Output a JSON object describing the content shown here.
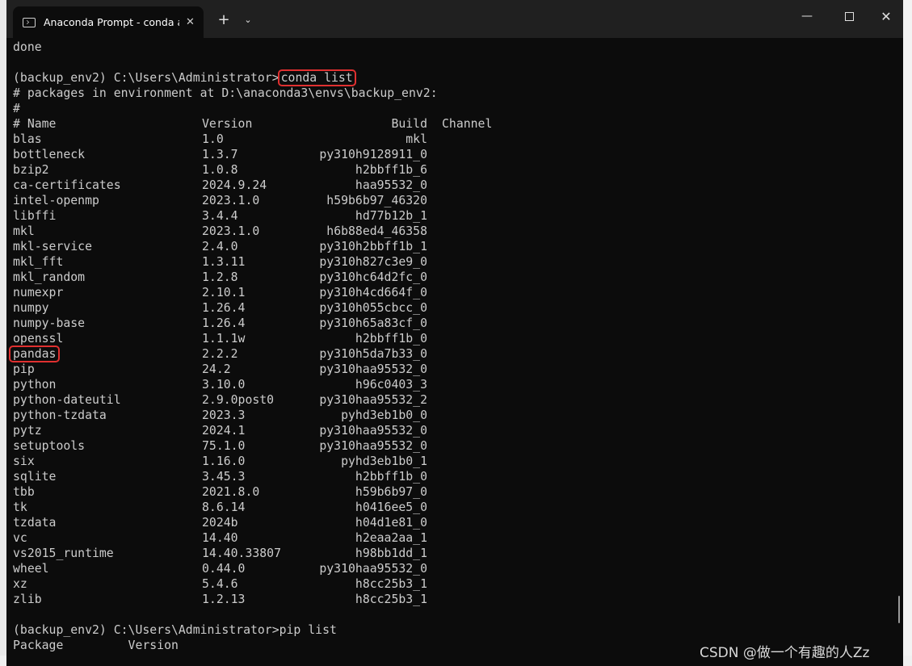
{
  "window": {
    "tab_title": "Anaconda Prompt - conda  ac",
    "tab_close": "✕",
    "new_tab": "+",
    "dropdown": "⌄",
    "minimize": "—",
    "close": "✕"
  },
  "terminal": {
    "pre_lines": [
      "done",
      ""
    ],
    "prompt1": "(backup_env2) C:\\Users\\Administrator>",
    "command1": "conda list",
    "env_comment": "# packages in environment at D:\\anaconda3\\envs\\backup_env2:",
    "hash_line": "#",
    "header": {
      "name": "# Name",
      "version": "Version",
      "build": "Build",
      "channel": "Channel"
    },
    "packages": [
      {
        "name": "blas",
        "version": "1.0",
        "build": "mkl"
      },
      {
        "name": "bottleneck",
        "version": "1.3.7",
        "build": "py310h9128911_0"
      },
      {
        "name": "bzip2",
        "version": "1.0.8",
        "build": "h2bbff1b_6"
      },
      {
        "name": "ca-certificates",
        "version": "2024.9.24",
        "build": "haa95532_0"
      },
      {
        "name": "intel-openmp",
        "version": "2023.1.0",
        "build": "h59b6b97_46320"
      },
      {
        "name": "libffi",
        "version": "3.4.4",
        "build": "hd77b12b_1"
      },
      {
        "name": "mkl",
        "version": "2023.1.0",
        "build": "h6b88ed4_46358"
      },
      {
        "name": "mkl-service",
        "version": "2.4.0",
        "build": "py310h2bbff1b_1"
      },
      {
        "name": "mkl_fft",
        "version": "1.3.11",
        "build": "py310h827c3e9_0"
      },
      {
        "name": "mkl_random",
        "version": "1.2.8",
        "build": "py310hc64d2fc_0"
      },
      {
        "name": "numexpr",
        "version": "2.10.1",
        "build": "py310h4cd664f_0"
      },
      {
        "name": "numpy",
        "version": "1.26.4",
        "build": "py310h055cbcc_0"
      },
      {
        "name": "numpy-base",
        "version": "1.26.4",
        "build": "py310h65a83cf_0"
      },
      {
        "name": "openssl",
        "version": "1.1.1w",
        "build": "h2bbff1b_0"
      },
      {
        "name": "pandas",
        "version": "2.2.2",
        "build": "py310h5da7b33_0"
      },
      {
        "name": "pip",
        "version": "24.2",
        "build": "py310haa95532_0"
      },
      {
        "name": "python",
        "version": "3.10.0",
        "build": "h96c0403_3"
      },
      {
        "name": "python-dateutil",
        "version": "2.9.0post0",
        "build": "py310haa95532_2"
      },
      {
        "name": "python-tzdata",
        "version": "2023.3",
        "build": "pyhd3eb1b0_0"
      },
      {
        "name": "pytz",
        "version": "2024.1",
        "build": "py310haa95532_0"
      },
      {
        "name": "setuptools",
        "version": "75.1.0",
        "build": "py310haa95532_0"
      },
      {
        "name": "six",
        "version": "1.16.0",
        "build": "pyhd3eb1b0_1"
      },
      {
        "name": "sqlite",
        "version": "3.45.3",
        "build": "h2bbff1b_0"
      },
      {
        "name": "tbb",
        "version": "2021.8.0",
        "build": "h59b6b97_0"
      },
      {
        "name": "tk",
        "version": "8.6.14",
        "build": "h0416ee5_0"
      },
      {
        "name": "tzdata",
        "version": "2024b",
        "build": "h04d1e81_0"
      },
      {
        "name": "vc",
        "version": "14.40",
        "build": "h2eaa2aa_1"
      },
      {
        "name": "vs2015_runtime",
        "version": "14.40.33807",
        "build": "h98bb1dd_1"
      },
      {
        "name": "wheel",
        "version": "0.44.0",
        "build": "py310haa95532_0"
      },
      {
        "name": "xz",
        "version": "5.4.6",
        "build": "h8cc25b3_1"
      },
      {
        "name": "zlib",
        "version": "1.2.13",
        "build": "h8cc25b3_1"
      }
    ],
    "highlighted_package": "pandas",
    "prompt2": "(backup_env2) C:\\Users\\Administrator>pip list",
    "pip_header": "Package         Version"
  },
  "watermark": "CSDN @做一个有趣的人Zz",
  "colors": {
    "terminal_bg": "#0c0c0c",
    "terminal_text": "#cccccc",
    "highlight_box": "#e03030"
  }
}
